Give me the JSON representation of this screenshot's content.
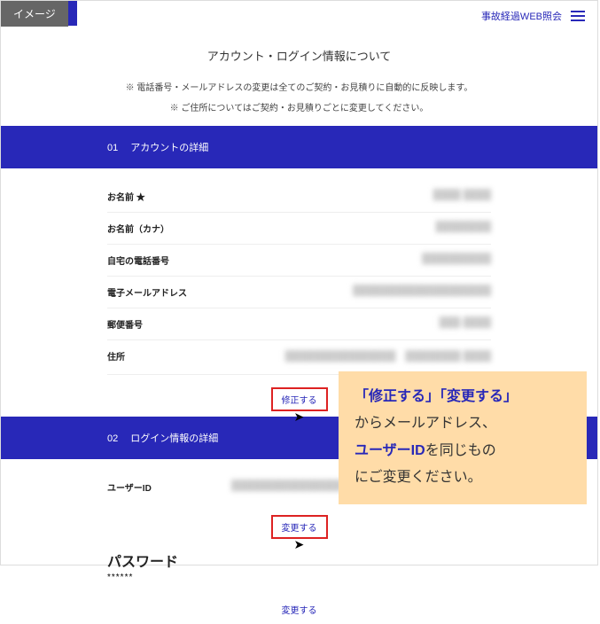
{
  "overlay": {
    "image_badge": "イメージ"
  },
  "header": {
    "link": "事故経過WEB照会"
  },
  "page": {
    "title": "アカウント・ログイン情報について",
    "note1": "※ 電話番号・メールアドレスの変更は全てのご契約・お見積りに自動的に反映します。",
    "note2": "※ ご住所についてはご契約・お見積りごとに変更してください。"
  },
  "section1": {
    "num": "01",
    "title": "アカウントの詳細",
    "rows": {
      "name": {
        "label": "お名前 ★",
        "value": "████ ████"
      },
      "kana": {
        "label": "お名前（カナ）",
        "value": "████████"
      },
      "phone": {
        "label": "自宅の電話番号",
        "value": "██████████"
      },
      "email": {
        "label": "電子メールアドレス",
        "value": "████████████████████"
      },
      "postal": {
        "label": "郵便番号",
        "value": "███-████"
      },
      "address": {
        "label": "住所",
        "value": "████████████████　████████\n████"
      }
    },
    "action": "修正する"
  },
  "section2": {
    "num": "02",
    "title": "ログイン情報の詳細",
    "rows": {
      "userid": {
        "label": "ユーザーID",
        "value": "████████████████"
      },
      "password": {
        "label": "パスワード",
        "dots": "******"
      }
    },
    "action1": "変更する",
    "action2": "変更する"
  },
  "callout": {
    "l1a": "「修正する」「変更する」",
    "l2a": "からメールアドレス、",
    "l3a": "ユーザーID",
    "l3b": "を同じもの",
    "l4a": "にご変更ください。"
  }
}
